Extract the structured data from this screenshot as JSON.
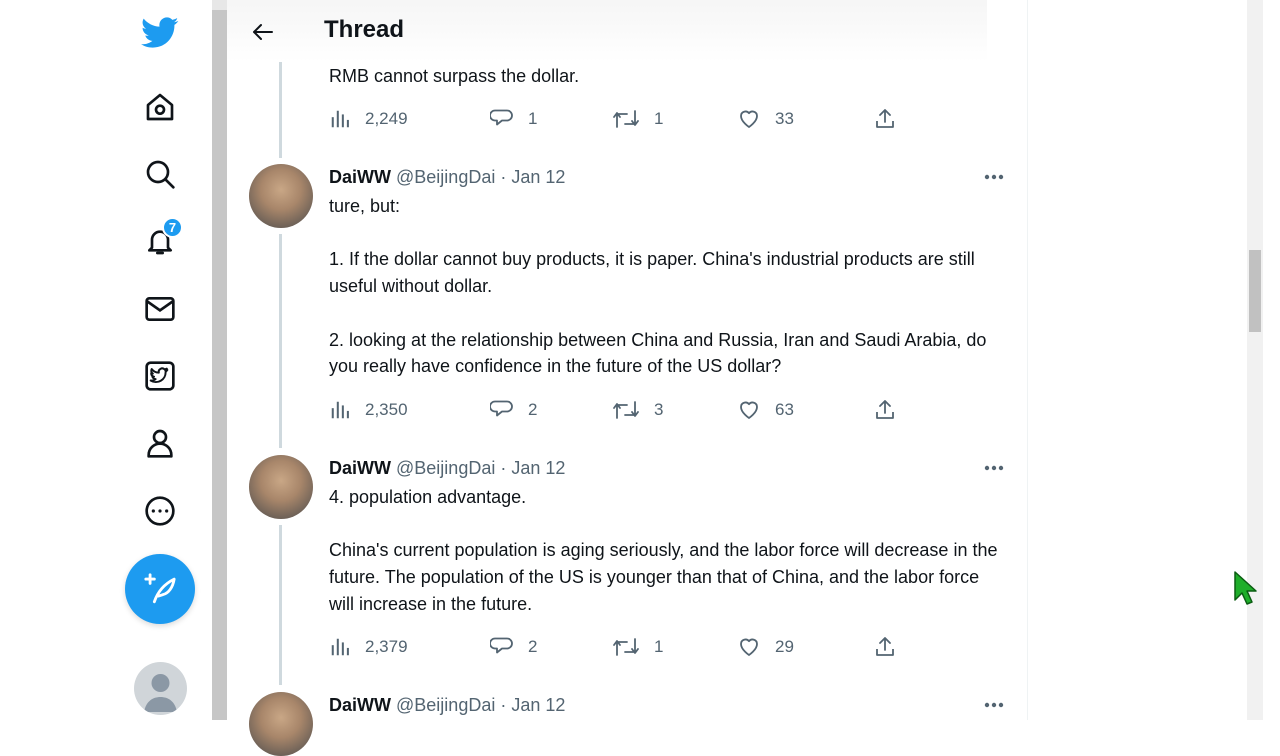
{
  "header": {
    "title": "Thread"
  },
  "nav": {
    "notification_count": "7"
  },
  "tweets": [
    {
      "text": "RMB cannot surpass the dollar.",
      "views": "2,249",
      "replies": "1",
      "retweets": "1",
      "likes": "33"
    },
    {
      "name": "DaiWW",
      "handle": "@BeijingDai",
      "date": "· Jan 12",
      "text": "ture, but:\n\n1. If the dollar cannot buy products, it is paper. China's industrial products are still useful without dollar.\n\n2. looking at the relationship between China and Russia, Iran and Saudi Arabia, do you really have confidence in the future of the US dollar?",
      "views": "2,350",
      "replies": "2",
      "retweets": "3",
      "likes": "63"
    },
    {
      "name": "DaiWW",
      "handle": "@BeijingDai",
      "date": "· Jan 12",
      "text": "4. population advantage.\n\nChina's current population is aging seriously, and the labor force will decrease in the future. The population of the US is younger than that of China, and the labor force will increase in the future.",
      "views": "2,379",
      "replies": "2",
      "retweets": "1",
      "likes": "29"
    },
    {
      "name": "DaiWW",
      "handle": "@BeijingDai",
      "date": "· Jan 12"
    }
  ],
  "colors": {
    "accent": "#1d9bf0",
    "text": "#0f1419",
    "secondary": "#536471"
  }
}
